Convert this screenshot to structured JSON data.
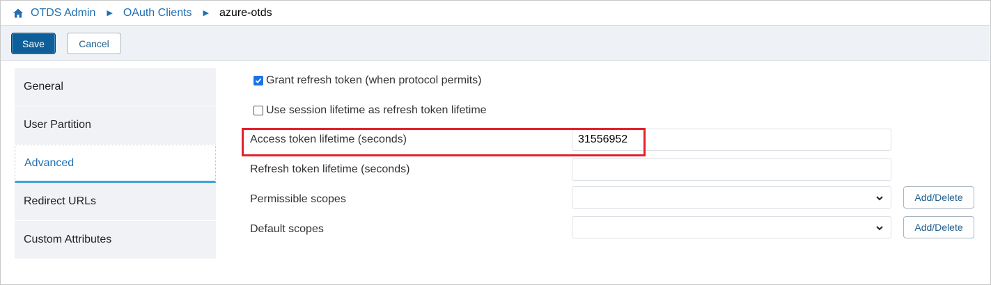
{
  "breadcrumb": {
    "home_icon": "home-icon",
    "items": [
      "OTDS Admin",
      "OAuth Clients"
    ],
    "current": "azure-otds",
    "separator_icon": "triangle-right-icon"
  },
  "toolbar": {
    "save_label": "Save",
    "cancel_label": "Cancel"
  },
  "sidebar": {
    "items": [
      {
        "label": "General"
      },
      {
        "label": "User Partition"
      },
      {
        "label": "Advanced"
      },
      {
        "label": "Redirect URLs"
      },
      {
        "label": "Custom Attributes"
      }
    ],
    "active": "Advanced"
  },
  "form": {
    "grant_refresh_label": "Grant refresh token (when protocol permits)",
    "grant_refresh_checked": true,
    "session_lifetime_label": "Use session lifetime as refresh token lifetime",
    "session_lifetime_checked": false,
    "access_token_label": "Access token lifetime (seconds)",
    "access_token_value": "31556952",
    "refresh_token_label": "Refresh token lifetime (seconds)",
    "refresh_token_value": "",
    "permissible_scopes_label": "Permissible scopes",
    "default_scopes_label": "Default scopes",
    "add_delete_label": "Add/Delete"
  },
  "colors": {
    "accent": "#0e5f99",
    "link": "#1f6fb2",
    "highlight": "#e3212b",
    "checkbox": "#1a73e8"
  }
}
